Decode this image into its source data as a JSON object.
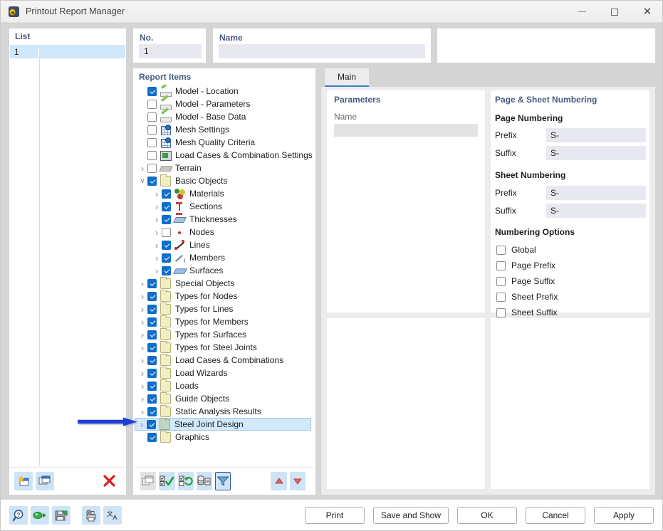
{
  "window": {
    "title": "Printout Report Manager",
    "icon": "app-icon",
    "controls": {
      "minimize": "–",
      "maximize": "□",
      "close": "✕"
    }
  },
  "list_panel": {
    "title": "List",
    "rows": [
      {
        "no": "1",
        "name": ""
      }
    ],
    "toolbar": [
      {
        "name": "new-report-button",
        "icon": "new-window-icon"
      },
      {
        "name": "copy-report-button",
        "icon": "copy-window-icon"
      },
      {
        "name": "delete-report-button",
        "icon": "red-x-icon"
      }
    ]
  },
  "no_field": {
    "label": "No.",
    "value": "1"
  },
  "name_field": {
    "label": "Name",
    "value": "",
    "placeholder": ""
  },
  "tree": {
    "title": "Report Items",
    "items": [
      {
        "label": "Model - Location",
        "indent": 0,
        "expander": "none",
        "checked": true,
        "icon": "model-icon"
      },
      {
        "label": "Model - Parameters",
        "indent": 0,
        "expander": "none",
        "checked": false,
        "icon": "model-icon"
      },
      {
        "label": "Model - Base Data",
        "indent": 0,
        "expander": "none",
        "checked": false,
        "icon": "model-icon"
      },
      {
        "label": "Mesh Settings",
        "indent": 0,
        "expander": "none",
        "checked": false,
        "icon": "mesh-icon"
      },
      {
        "label": "Mesh Quality Criteria",
        "indent": 0,
        "expander": "none",
        "checked": false,
        "icon": "mesh-icon"
      },
      {
        "label": "Load Cases & Combination Settings",
        "indent": 0,
        "expander": "none",
        "checked": false,
        "icon": "loadcase-icon"
      },
      {
        "label": "Terrain",
        "indent": 0,
        "expander": "closed",
        "checked": false,
        "icon": "terrain-icon"
      },
      {
        "label": "Basic Objects",
        "indent": 0,
        "expander": "open",
        "checked": true,
        "icon": "folder-icon"
      },
      {
        "label": "Materials",
        "indent": 1,
        "expander": "closed",
        "checked": true,
        "icon": "materials-icon"
      },
      {
        "label": "Sections",
        "indent": 1,
        "expander": "closed",
        "checked": true,
        "icon": "section-icon"
      },
      {
        "label": "Thicknesses",
        "indent": 1,
        "expander": "closed",
        "checked": true,
        "icon": "thickness-icon"
      },
      {
        "label": "Nodes",
        "indent": 1,
        "expander": "closed",
        "checked": false,
        "icon": "node-icon"
      },
      {
        "label": "Lines",
        "indent": 1,
        "expander": "closed",
        "checked": true,
        "icon": "line-icon"
      },
      {
        "label": "Members",
        "indent": 1,
        "expander": "closed",
        "checked": true,
        "icon": "member-icon"
      },
      {
        "label": "Surfaces",
        "indent": 1,
        "expander": "closed",
        "checked": true,
        "icon": "surface-icon"
      },
      {
        "label": "Special Objects",
        "indent": 0,
        "expander": "closed",
        "checked": true,
        "icon": "folder-icon"
      },
      {
        "label": "Types for Nodes",
        "indent": 0,
        "expander": "closed",
        "checked": true,
        "icon": "folder-icon"
      },
      {
        "label": "Types for Lines",
        "indent": 0,
        "expander": "closed",
        "checked": true,
        "icon": "folder-icon"
      },
      {
        "label": "Types for Members",
        "indent": 0,
        "expander": "closed",
        "checked": true,
        "icon": "folder-icon"
      },
      {
        "label": "Types for Surfaces",
        "indent": 0,
        "expander": "closed",
        "checked": true,
        "icon": "folder-icon"
      },
      {
        "label": "Types for Steel Joints",
        "indent": 0,
        "expander": "closed",
        "checked": true,
        "icon": "folder-icon"
      },
      {
        "label": "Load Cases & Combinations",
        "indent": 0,
        "expander": "closed",
        "checked": true,
        "icon": "folder-icon"
      },
      {
        "label": "Load Wizards",
        "indent": 0,
        "expander": "closed",
        "checked": true,
        "icon": "folder-icon"
      },
      {
        "label": "Loads",
        "indent": 0,
        "expander": "closed",
        "checked": true,
        "icon": "folder-icon"
      },
      {
        "label": "Guide Objects",
        "indent": 0,
        "expander": "closed",
        "checked": true,
        "icon": "folder-icon"
      },
      {
        "label": "Static Analysis Results",
        "indent": 0,
        "expander": "closed",
        "checked": true,
        "icon": "folder-icon"
      },
      {
        "label": "Steel Joint Design",
        "indent": 0,
        "expander": "closed",
        "checked": true,
        "icon": "folder-green-icon",
        "selected": true
      },
      {
        "label": "Graphics",
        "indent": 0,
        "expander": "none",
        "checked": true,
        "icon": "folder-icon"
      }
    ],
    "toolbar": [
      {
        "name": "duplicate-item-button",
        "icon": "copy-window-icon",
        "state": "disabled"
      },
      {
        "name": "select-all-button",
        "icon": "check-all-icon",
        "state": "normal"
      },
      {
        "name": "invert-selection-button",
        "icon": "invert-check-icon",
        "state": "normal"
      },
      {
        "name": "list-items-button",
        "icon": "list-detail-icon",
        "state": "normal"
      },
      {
        "name": "filter-button",
        "icon": "funnel-icon",
        "state": "active"
      },
      {
        "name": "move-up-button",
        "icon": "arrow-up-icon",
        "state": "normal"
      },
      {
        "name": "move-down-button",
        "icon": "arrow-down-icon",
        "state": "normal"
      }
    ]
  },
  "right_panel": {
    "tabs": [
      {
        "label": "Main",
        "active": true
      }
    ],
    "parameters": {
      "title": "Parameters",
      "name_label": "Name",
      "name_value": ""
    },
    "numbering": {
      "title": "Page & Sheet Numbering",
      "page_section": "Page Numbering",
      "page_prefix_label": "Prefix",
      "page_prefix_value": "S-",
      "page_suffix_label": "Suffix",
      "page_suffix_value": "S-",
      "sheet_section": "Sheet Numbering",
      "sheet_prefix_label": "Prefix",
      "sheet_prefix_value": "S-",
      "sheet_suffix_label": "Suffix",
      "sheet_suffix_value": "S-",
      "options_title": "Numbering Options",
      "options": [
        {
          "label": "Global",
          "checked": false
        },
        {
          "label": "Page Prefix",
          "checked": false
        },
        {
          "label": "Page Suffix",
          "checked": false
        },
        {
          "label": "Sheet Prefix",
          "checked": false
        },
        {
          "label": "Sheet Suffix",
          "checked": false
        }
      ]
    }
  },
  "footer": {
    "tools": [
      {
        "name": "help-button",
        "icon": "question-magnifier-icon"
      },
      {
        "name": "export-button",
        "icon": "green-export-icon"
      },
      {
        "name": "save-template-button",
        "icon": "floppy-green-icon"
      },
      {
        "name": "printer-settings-button",
        "icon": "printer-gear-icon"
      },
      {
        "name": "language-button",
        "icon": "translate-icon"
      }
    ],
    "buttons": [
      {
        "label": "Print",
        "name": "print-button"
      },
      {
        "label": "Save and Show",
        "name": "save-and-show-button"
      },
      {
        "label": "OK",
        "name": "ok-button"
      },
      {
        "label": "Cancel",
        "name": "cancel-button"
      },
      {
        "label": "Apply",
        "name": "apply-button"
      }
    ]
  },
  "annotation": {
    "arrow_color": "#1f3fd8",
    "points_to": "Steel Joint Design"
  },
  "colors": {
    "accent": "#0e6ecb",
    "group_title": "#4a5b82",
    "selection": "#d2e9fb",
    "field_bg": "#e8e8f0",
    "window_bg": "#d5d5d5"
  }
}
